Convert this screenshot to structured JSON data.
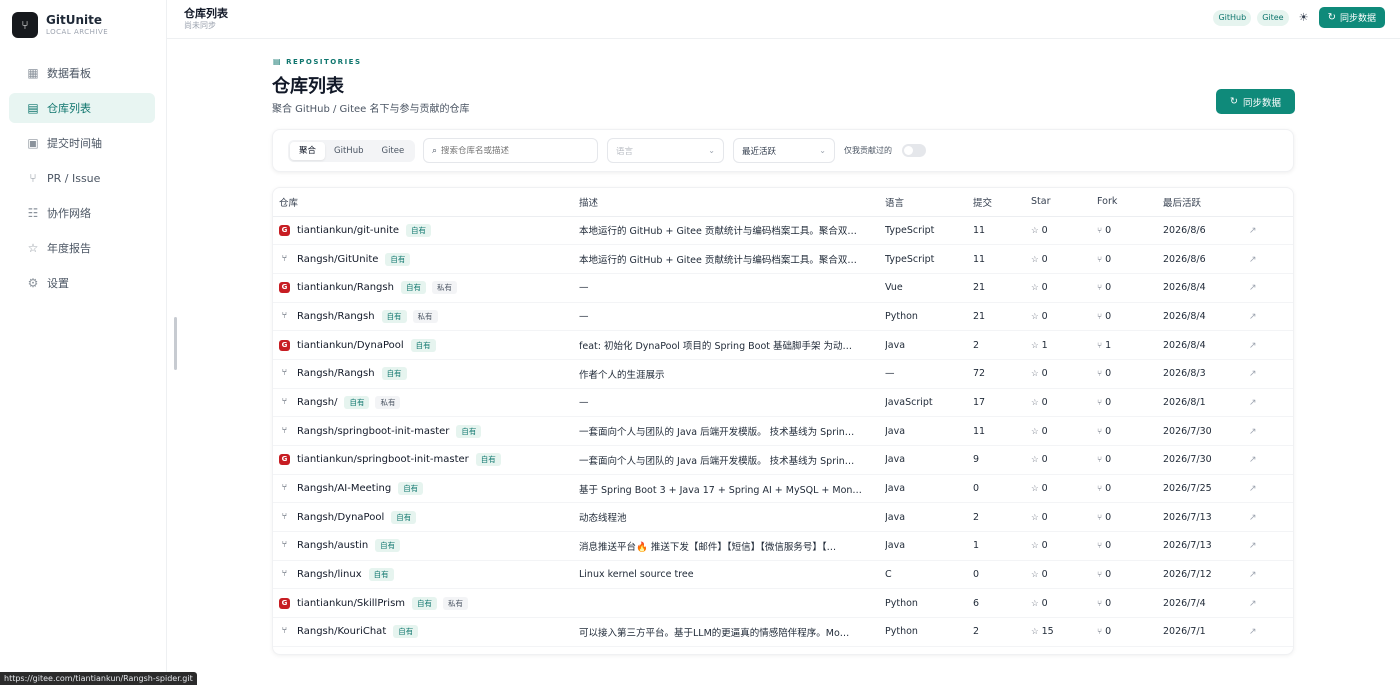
{
  "brand": {
    "name": "GitUnite",
    "sub": "LOCAL ARCHIVE"
  },
  "sidebar": {
    "items": [
      {
        "label": "数据看板",
        "icon": "dashboard-icon"
      },
      {
        "label": "仓库列表",
        "icon": "repo-folder-icon",
        "active": true
      },
      {
        "label": "提交时间轴",
        "icon": "calendar-icon"
      },
      {
        "label": "PR / Issue",
        "icon": "pull-request-icon"
      },
      {
        "label": "协作网络",
        "icon": "network-icon"
      },
      {
        "label": "年度报告",
        "icon": "award-icon"
      },
      {
        "label": "设置",
        "icon": "gear-icon"
      }
    ]
  },
  "topbar": {
    "title": "仓库列表",
    "subtitle": "尚未同步",
    "badges": [
      "GitHub",
      "Gitee"
    ],
    "sync_label": "同步数据"
  },
  "header": {
    "eyebrow": "REPOSITORIES",
    "title": "仓库列表",
    "description": "聚合 GitHub / Gitee 名下与参与贡献的仓库",
    "sync_label": "同步数据"
  },
  "filters": {
    "segments": [
      "聚合",
      "GitHub",
      "Gitee"
    ],
    "active_segment": "聚合",
    "search_placeholder": "搜索仓库名或描述",
    "language_placeholder": "语言",
    "sort_value": "最近活跃",
    "toggle_label": "仅我贡献过的",
    "toggle_on": false
  },
  "table": {
    "columns": [
      "仓库",
      "描述",
      "语言",
      "提交",
      "Star",
      "Fork",
      "最后活跃"
    ],
    "own_tag": "自有",
    "private_tag": "私有",
    "rows": [
      {
        "source": "gitee",
        "name": "tiantiankun/git-unite",
        "private": false,
        "desc": "本地运行的 GitHub + Gitee 贡献统计与编码档案工具。聚合双…",
        "lang": "TypeScript",
        "commits": "11",
        "star": "0",
        "fork": "0",
        "last": "2026/8/6"
      },
      {
        "source": "github",
        "name": "Rangsh/GitUnite",
        "private": false,
        "desc": "本地运行的 GitHub + Gitee 贡献统计与编码档案工具。聚合双…",
        "lang": "TypeScript",
        "commits": "11",
        "star": "0",
        "fork": "0",
        "last": "2026/8/6"
      },
      {
        "source": "gitee",
        "name": "tiantiankun/Rangsh",
        "private": true,
        "desc": "—",
        "lang": "Vue",
        "commits": "21",
        "star": "0",
        "fork": "0",
        "last": "2026/8/4"
      },
      {
        "source": "github",
        "name": "Rangsh/Rangsh",
        "private": true,
        "desc": "—",
        "lang": "Python",
        "commits": "21",
        "star": "0",
        "fork": "0",
        "last": "2026/8/4"
      },
      {
        "source": "gitee",
        "name": "tiantiankun/DynaPool",
        "private": false,
        "desc": "feat: 初始化 DynaPool 项目的 Spring Boot 基础脚手架 为动…",
        "lang": "Java",
        "commits": "2",
        "star": "1",
        "fork": "1",
        "last": "2026/8/4"
      },
      {
        "source": "github",
        "name": "Rangsh/Rangsh",
        "private": false,
        "desc": "作者个人的生涯展示",
        "lang": "—",
        "commits": "72",
        "star": "0",
        "fork": "0",
        "last": "2026/8/3"
      },
      {
        "source": "github",
        "name": "Rangsh/",
        "private": true,
        "desc": "—",
        "lang": "JavaScript",
        "commits": "17",
        "star": "0",
        "fork": "0",
        "last": "2026/8/1"
      },
      {
        "source": "github",
        "name": "Rangsh/springboot-init-master",
        "private": false,
        "desc": "一套面向个人与团队的 Java 后端开发模版。 技术基线为 Sprin…",
        "lang": "Java",
        "commits": "11",
        "star": "0",
        "fork": "0",
        "last": "2026/7/30"
      },
      {
        "source": "gitee",
        "name": "tiantiankun/springboot-init-master",
        "private": false,
        "desc": "一套面向个人与团队的 Java 后端开发模版。 技术基线为 Sprin…",
        "lang": "Java",
        "commits": "9",
        "star": "0",
        "fork": "0",
        "last": "2026/7/30"
      },
      {
        "source": "github",
        "name": "Rangsh/AI-Meeting",
        "private": false,
        "desc": "基于 Spring Boot 3 + Java 17 + Spring AI + MySQL + Mon…",
        "lang": "Java",
        "commits": "0",
        "star": "0",
        "fork": "0",
        "last": "2026/7/25"
      },
      {
        "source": "github",
        "name": "Rangsh/DynaPool",
        "private": false,
        "desc": "动态线程池",
        "lang": "Java",
        "commits": "2",
        "star": "0",
        "fork": "0",
        "last": "2026/7/13"
      },
      {
        "source": "github",
        "name": "Rangsh/austin",
        "private": false,
        "desc": "消息推送平台🔥 推送下发【邮件】【短信】【微信服务号】【…",
        "lang": "Java",
        "commits": "1",
        "star": "0",
        "fork": "0",
        "last": "2026/7/13"
      },
      {
        "source": "github",
        "name": "Rangsh/linux",
        "private": false,
        "desc": "Linux kernel source tree",
        "lang": "C",
        "commits": "0",
        "star": "0",
        "fork": "0",
        "last": "2026/7/12"
      },
      {
        "source": "gitee",
        "name": "tiantiankun/SkillPrism",
        "private": true,
        "desc": "",
        "lang": "Python",
        "commits": "6",
        "star": "0",
        "fork": "0",
        "last": "2026/7/4"
      },
      {
        "source": "github",
        "name": "Rangsh/KouriChat",
        "private": false,
        "desc": "可以接入第三方平台。基于LLM的更逼真的情感陪伴程序。Mo…",
        "lang": "Python",
        "commits": "2",
        "star": "15",
        "fork": "0",
        "last": "2026/7/1"
      }
    ]
  },
  "statusbar": {
    "url": "https://gitee.com/tiantiankun/Rangsh-spider.git"
  }
}
